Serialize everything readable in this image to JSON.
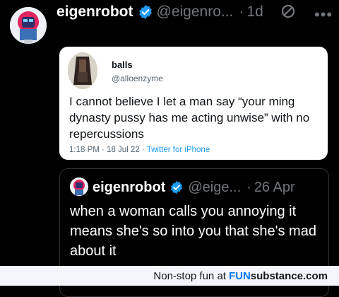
{
  "tweet": {
    "author_name": "eigenrobot",
    "author_handle": "@eigenro...",
    "dot": "·",
    "time": "1d",
    "more_icon": "more-icon",
    "mute_icon": "mute-icon"
  },
  "quoted_image": {
    "author_name": "balls",
    "author_handle": "@alloenzyme",
    "text": "I cannot believe I let a man say “your ming dynasty pussy has me acting unwise” with no repercussions",
    "timestamp": "1:18 PM · 18 Jul 22 · ",
    "source": "Twitter for iPhone"
  },
  "quote_tweet": {
    "author_name": "eigenrobot",
    "author_handle": "@eige...",
    "dot": "·",
    "time": "26 Apr",
    "text": "when a woman calls you annoying it means she's so into you that she's mad about it"
  },
  "footer": {
    "text": "Non-stop fun at ",
    "brand_prefix": "FUN",
    "brand_suffix": "substance.com"
  },
  "colors": {
    "verified": "#1d9bf0",
    "muted_text": "#71767b",
    "link": "#1d9bf0",
    "accent": "#0077ff"
  }
}
